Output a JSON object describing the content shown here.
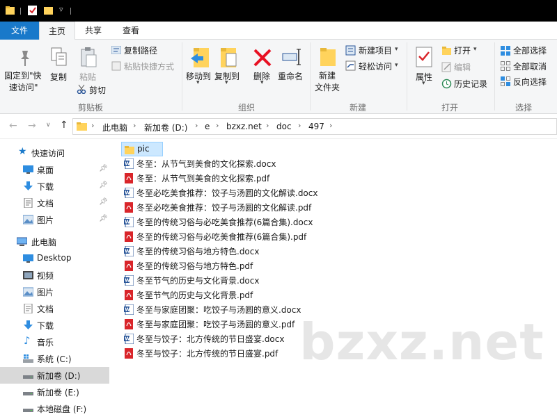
{
  "ribbon_tabs": [
    "文件",
    "主页",
    "共享",
    "查看"
  ],
  "clipboard": {
    "pin_label_1": "固定到\"快",
    "pin_label_2": "速访问\"",
    "copy_label": "复制",
    "paste_label": "粘贴",
    "copy_path_label": "复制路径",
    "paste_shortcut_label": "粘贴快捷方式",
    "cut_label": "剪切",
    "group_label": "剪贴板"
  },
  "organize": {
    "move_to_label": "移动到",
    "copy_to_label": "复制到",
    "delete_label": "删除",
    "rename_label": "重命名",
    "group_label": "组织"
  },
  "new": {
    "new_folder_label_1": "新建",
    "new_folder_label_2": "文件夹",
    "new_item_label": "新建项目",
    "easy_access_label": "轻松访问",
    "group_label": "新建"
  },
  "open": {
    "properties_label": "属性",
    "open_label": "打开",
    "edit_label": "编辑",
    "history_label": "历史记录",
    "group_label": "打开"
  },
  "select": {
    "select_all_label": "全部选择",
    "select_none_label": "全部取消",
    "invert_label": "反向选择",
    "group_label": "选择"
  },
  "breadcrumb": [
    "此电脑",
    "新加卷 (D:)",
    "e",
    "bzxz.net",
    "doc",
    "497"
  ],
  "nav": {
    "quick_access_label": "快速访问",
    "quick_items": [
      "桌面",
      "下载",
      "文档",
      "图片"
    ],
    "this_pc_label": "此电脑",
    "pc_items": [
      "Desktop",
      "视频",
      "图片",
      "文档",
      "下载",
      "音乐",
      "系统 (C:)",
      "新加卷 (D:)",
      "新加卷 (E:)",
      "本地磁盘 (F:)"
    ]
  },
  "files": [
    {
      "name": "pic",
      "type": "folder"
    },
    {
      "name": "冬至：从节气到美食的文化探索.docx",
      "type": "docx"
    },
    {
      "name": "冬至：从节气到美食的文化探索.pdf",
      "type": "pdf"
    },
    {
      "name": "冬至必吃美食推荐：饺子与汤圆的文化解读.docx",
      "type": "docx"
    },
    {
      "name": "冬至必吃美食推荐：饺子与汤圆的文化解读.pdf",
      "type": "pdf"
    },
    {
      "name": "冬至的传统习俗与必吃美食推荐(6篇合集).docx",
      "type": "docx"
    },
    {
      "name": "冬至的传统习俗与必吃美食推荐(6篇合集).pdf",
      "type": "pdf"
    },
    {
      "name": "冬至的传统习俗与地方特色.docx",
      "type": "docx"
    },
    {
      "name": "冬至的传统习俗与地方特色.pdf",
      "type": "pdf"
    },
    {
      "name": "冬至节气的历史与文化背景.docx",
      "type": "docx"
    },
    {
      "name": "冬至节气的历史与文化背景.pdf",
      "type": "pdf"
    },
    {
      "name": "冬至与家庭团聚：吃饺子与汤圆的意义.docx",
      "type": "docx"
    },
    {
      "name": "冬至与家庭团聚：吃饺子与汤圆的意义.pdf",
      "type": "pdf"
    },
    {
      "name": "冬至与饺子：北方传统的节日盛宴.docx",
      "type": "docx"
    },
    {
      "name": "冬至与饺子：北方传统的节日盛宴.pdf",
      "type": "pdf"
    }
  ],
  "watermark": "bzxz.net",
  "colors": {
    "accent": "#1979ca",
    "selection": "#cce8ff",
    "folder": "#ffd35c",
    "pdf": "#d9252a",
    "docx": "#2b579a"
  }
}
